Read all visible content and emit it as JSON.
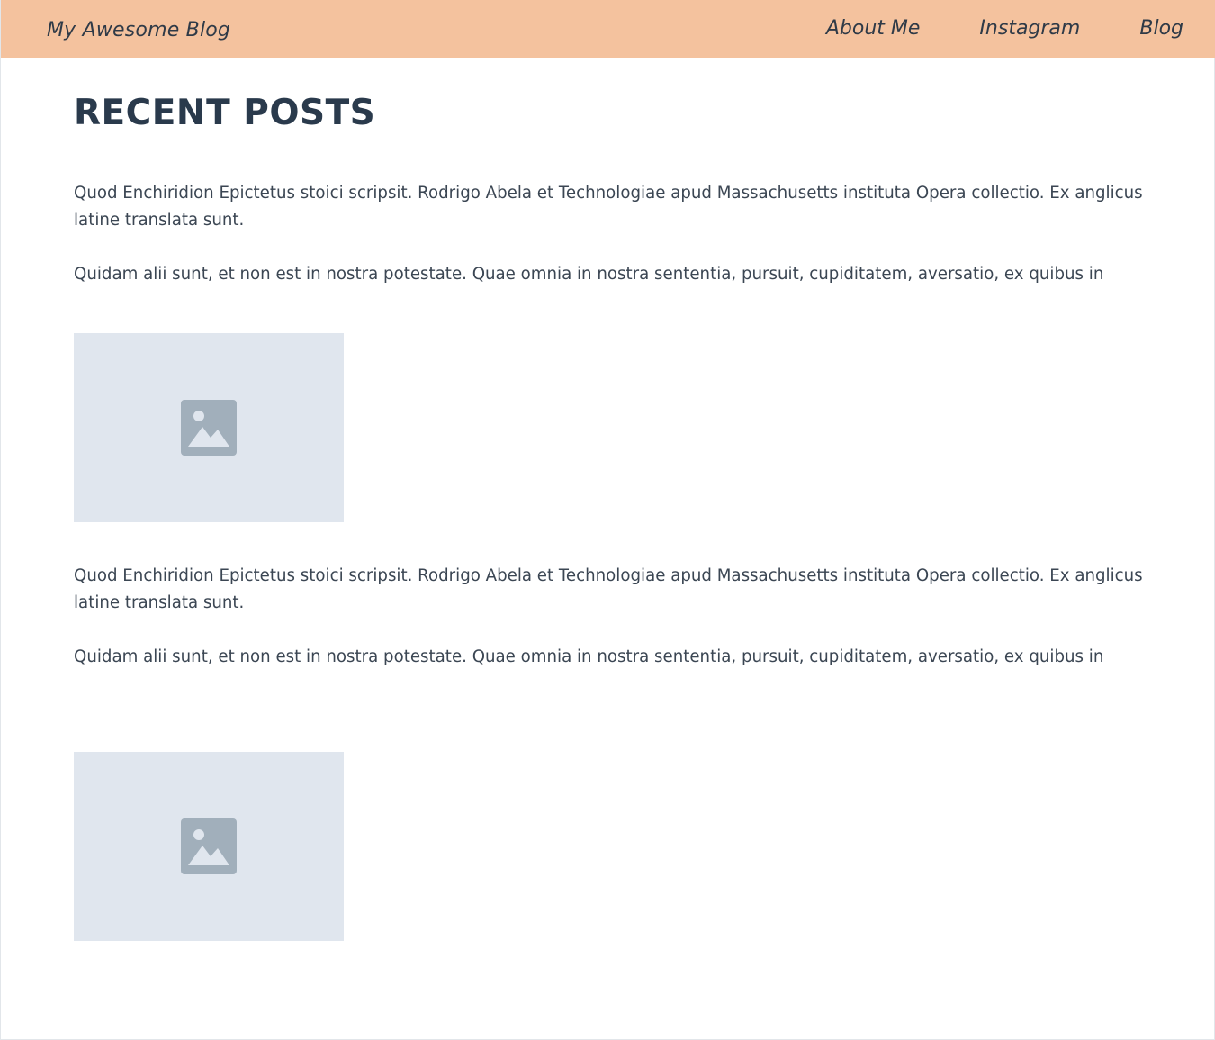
{
  "header": {
    "brand": "My Awesome Blog",
    "nav": [
      {
        "label": "About Me"
      },
      {
        "label": "Instagram"
      },
      {
        "label": "Blog"
      }
    ],
    "background_color": "#f4c29e"
  },
  "main": {
    "title": "RECENT POSTS",
    "posts": [
      {
        "paragraph_1": "Quod Enchiridion Epictetus stoici scripsit. Rodrigo Abela et Technologiae apud Massachusetts instituta Opera collectio. Ex anglicus latine translata sunt.",
        "paragraph_2": "Quidam alii sunt, et non est in nostra potestate. Quae omnia in nostra sententia, pursuit, cupiditatem, aversatio, ex quibus in",
        "image_icon": "image-placeholder-icon"
      },
      {
        "paragraph_1": "Quod Enchiridion Epictetus stoici scripsit. Rodrigo Abela et Technologiae apud Massachusetts instituta Opera collectio. Ex anglicus latine translata sunt.",
        "paragraph_2": "Quidam alii sunt, et non est in nostra potestate. Quae omnia in nostra sententia, pursuit, cupiditatem, aversatio, ex quibus in",
        "image_icon": "image-placeholder-icon"
      }
    ]
  },
  "colors": {
    "text": "#3b4653",
    "title": "#2a3a4c",
    "placeholder_bg": "#e0e6ee",
    "placeholder_icon": "#a1afbb"
  }
}
